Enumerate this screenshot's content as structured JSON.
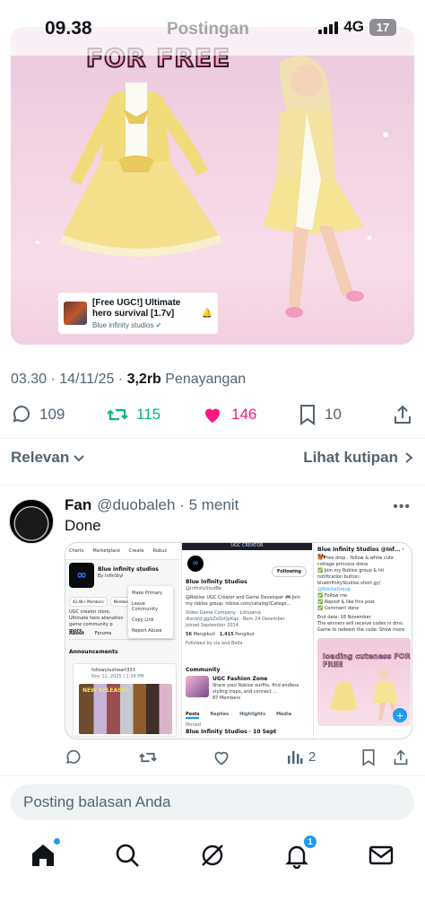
{
  "status_bar": {
    "time": "09.38",
    "screen_title": "Postingan",
    "network": "4G",
    "battery": "17"
  },
  "hero": {
    "banner_text": "FOR FREE",
    "card": {
      "title": "[Free UGC!] Ultimate hero survival [1.7v]",
      "subtitle": "Blue infinity studios"
    }
  },
  "tweet": {
    "time": "03.30",
    "date": "14/11/25",
    "views": "3,2rb",
    "views_label": "Penayangan",
    "replies": "109",
    "reposts": "115",
    "likes": "146",
    "bookmarks": "10"
  },
  "sort": {
    "left_label": "Relevan",
    "right_label": "Lihat kutipan"
  },
  "reply": {
    "name": "Fan",
    "handle": "@duobaleh",
    "time": "5 menit",
    "text": "Done",
    "views": "2",
    "collage": {
      "pane1": {
        "nav": [
          "Charts",
          "Marketplace",
          "Create",
          "Robux"
        ],
        "title": "Blue infinity studios",
        "by": "By InfinStyl",
        "menu": [
          "Make Primary",
          "Leave Community",
          "Copy Link",
          "Report Abuse"
        ],
        "stats": [
          "43.4K+ Members",
          "Member"
        ],
        "desc": "UGC creator store, Ultimate hero alienation game community p",
        "more": "more",
        "tabs": [
          "About",
          "Forums"
        ],
        "announcements": "Announcements",
        "post_user": "followyourheart333",
        "post_date": "Nov 11, 2025 | 1:34 PM",
        "post_label": "NEW RELEASES"
      },
      "pane2": {
        "header": "UGC CREATOR",
        "following": "Following",
        "name": "Blue Infinity Studios",
        "handle": "@InfinityStudBe",
        "bio": "@Roblox UGC Creator and Game Developer 🎮 Join my roblox group: roblox.com/catalog?Catego...",
        "category": "Video Game Company",
        "location": "Lithuania",
        "link": "discord.gg/sZsDzQpKqz",
        "born": "Born 24 Desember",
        "joined": "Joined September 2014",
        "following_count": "56",
        "following_label": "Mengikuti",
        "followers_count": "1.415",
        "followers_label": "Pengikut",
        "followed_by": "Followed by cla and Bella",
        "community_label": "Community",
        "community_title": "UGC Fashion Zone",
        "community_desc": "Share your Roblox outfits, find endless styling inspo, and connect ...",
        "community_members": "87 Members",
        "tabs": [
          "Posts",
          "Replies",
          "Highlights",
          "Media"
        ],
        "pinned": "Pinned",
        "post_head": "Blue Infinity Studios · 10 Sept"
      },
      "pane3": {
        "head": "Blue Infinity Studios @Inf... · 5h",
        "lines": [
          "🎁 Free drop : Yellow & white cute cottage princess dress",
          "✅ Join my Roblox group & hit notification button: blueinfinityStudios.short.gy/",
          "@RobloxGroup",
          "✅ Follow me",
          "✅ Repost & like this post",
          "✅ Comment done",
          "End date: 18 November",
          "The winners will receive codes in dms.",
          "Game to redeem the code: Show more"
        ],
        "image_title": "loading cuteness FOR FREE"
      }
    }
  },
  "composer": {
    "placeholder": "Posting balasan Anda"
  },
  "tabbar": {
    "notification_count": "1",
    "items": [
      "home-icon",
      "search-icon",
      "grok-icon",
      "bell-icon",
      "mail-icon"
    ]
  },
  "colors": {
    "text_primary": "#0f1419",
    "text_secondary": "#536471",
    "repost_green": "#00ba7c",
    "like_pink": "#f91880",
    "accent_blue": "#1d9bf0"
  }
}
